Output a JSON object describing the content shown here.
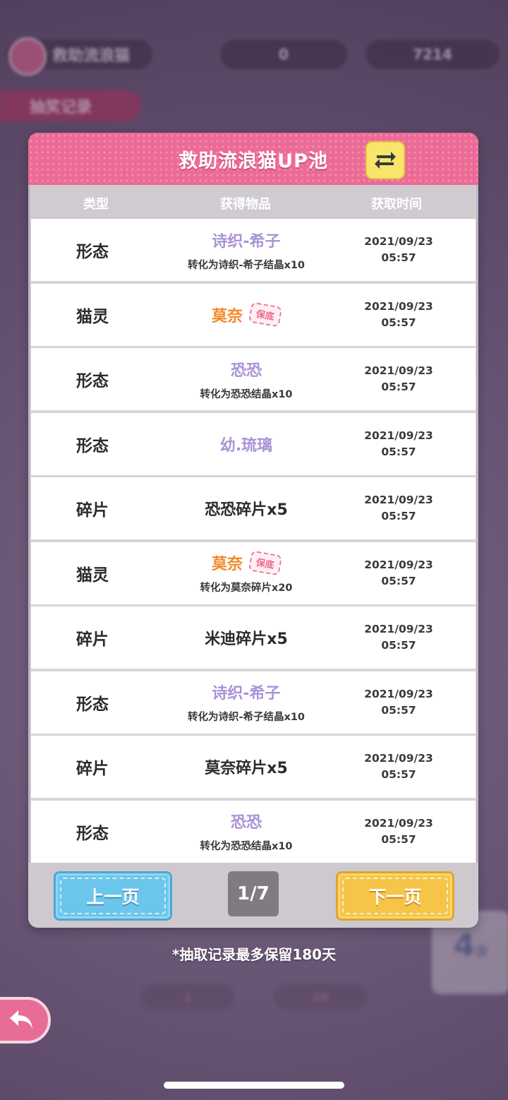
{
  "background": {
    "event_tab_label": "救助流浪猫",
    "coin_value": "0",
    "gem_value": "7214",
    "record_tab_label": "抽奖记录",
    "side_counter_number": "4",
    "side_counter_unit": "次",
    "bottom_cost_1": "1",
    "bottom_cost_2": "10"
  },
  "dialog": {
    "title": "救助流浪猫UP池",
    "columns": [
      "类型",
      "获得物品",
      "获取时间"
    ],
    "rows": [
      {
        "type": "形态",
        "item": "诗织-希子",
        "item_color": "purple",
        "sub": "转化为诗织-希子结晶x10",
        "stamp": "",
        "date": "2021/09/23",
        "time": "05:57"
      },
      {
        "type": "猫灵",
        "item": "莫奈",
        "item_color": "orange",
        "sub": "",
        "stamp": "保底",
        "date": "2021/09/23",
        "time": "05:57"
      },
      {
        "type": "形态",
        "item": "恐恐",
        "item_color": "purple",
        "sub": "转化为恐恐结晶x10",
        "stamp": "",
        "date": "2021/09/23",
        "time": "05:57"
      },
      {
        "type": "形态",
        "item": "幼.琉璃",
        "item_color": "purple",
        "sub": "",
        "stamp": "",
        "date": "2021/09/23",
        "time": "05:57"
      },
      {
        "type": "碎片",
        "item": "恐恐碎片x5",
        "item_color": "black",
        "sub": "",
        "stamp": "",
        "date": "2021/09/23",
        "time": "05:57"
      },
      {
        "type": "猫灵",
        "item": "莫奈",
        "item_color": "orange",
        "sub": "转化为莫奈碎片x20",
        "stamp": "保底",
        "date": "2021/09/23",
        "time": "05:57"
      },
      {
        "type": "碎片",
        "item": "米迪碎片x5",
        "item_color": "black",
        "sub": "",
        "stamp": "",
        "date": "2021/09/23",
        "time": "05:57"
      },
      {
        "type": "形态",
        "item": "诗织-希子",
        "item_color": "purple",
        "sub": "转化为诗织-希子结晶x10",
        "stamp": "",
        "date": "2021/09/23",
        "time": "05:57"
      },
      {
        "type": "碎片",
        "item": "莫奈碎片x5",
        "item_color": "black",
        "sub": "",
        "stamp": "",
        "date": "2021/09/23",
        "time": "05:57"
      },
      {
        "type": "形态",
        "item": "恐恐",
        "item_color": "purple",
        "sub": "转化为恐恐结晶x10",
        "stamp": "",
        "date": "2021/09/23",
        "time": "05:57"
      }
    ],
    "prev_label": "上一页",
    "next_label": "下一页",
    "page_indicator": "1/7"
  },
  "note": "*抽取记录最多保留180天",
  "colors": {
    "accent_pink": "#ec6b96",
    "item_purple": "#a993d6",
    "item_orange": "#f28a2a",
    "prev_blue": "#6cc6ec",
    "next_yellow": "#f6c548"
  },
  "icons": {
    "switch": "swap-arrows-icon",
    "back": "back-arrow-icon"
  }
}
